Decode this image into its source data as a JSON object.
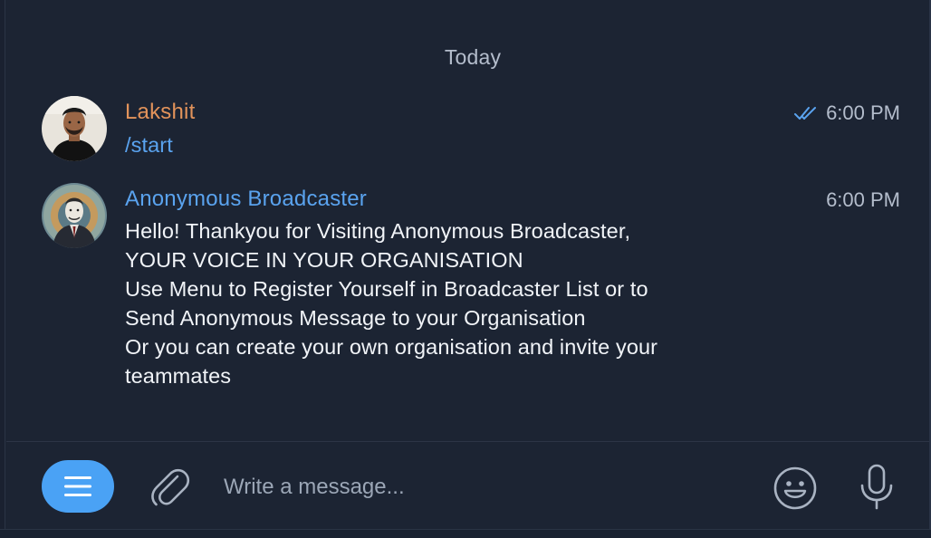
{
  "chat": {
    "date_separator": "Today",
    "messages": [
      {
        "sender": "Lakshit",
        "text": "/start",
        "time": "6:00 PM",
        "read": true,
        "sender_color": "#e2935b"
      },
      {
        "sender": "Anonymous Broadcaster",
        "time": "6:00 PM",
        "sender_color": "#5aa3ef",
        "lines": [
          "Hello! Thankyou for Visiting Anonymous Broadcaster,",
          "YOUR VOICE IN YOUR ORGANISATION",
          "Use Menu to Register Yourself in Broadcaster List or to",
          "Send Anonymous Message to your Organisation",
          "Or you can create your own organisation and invite your",
          "teammates"
        ]
      }
    ]
  },
  "composer": {
    "placeholder": "Write a message...",
    "menu_icon": "hamburger-menu-icon",
    "attach_icon": "paperclip-icon",
    "emoji_icon": "smiley-icon",
    "mic_icon": "microphone-icon",
    "accent_color": "#4aa2f5"
  }
}
